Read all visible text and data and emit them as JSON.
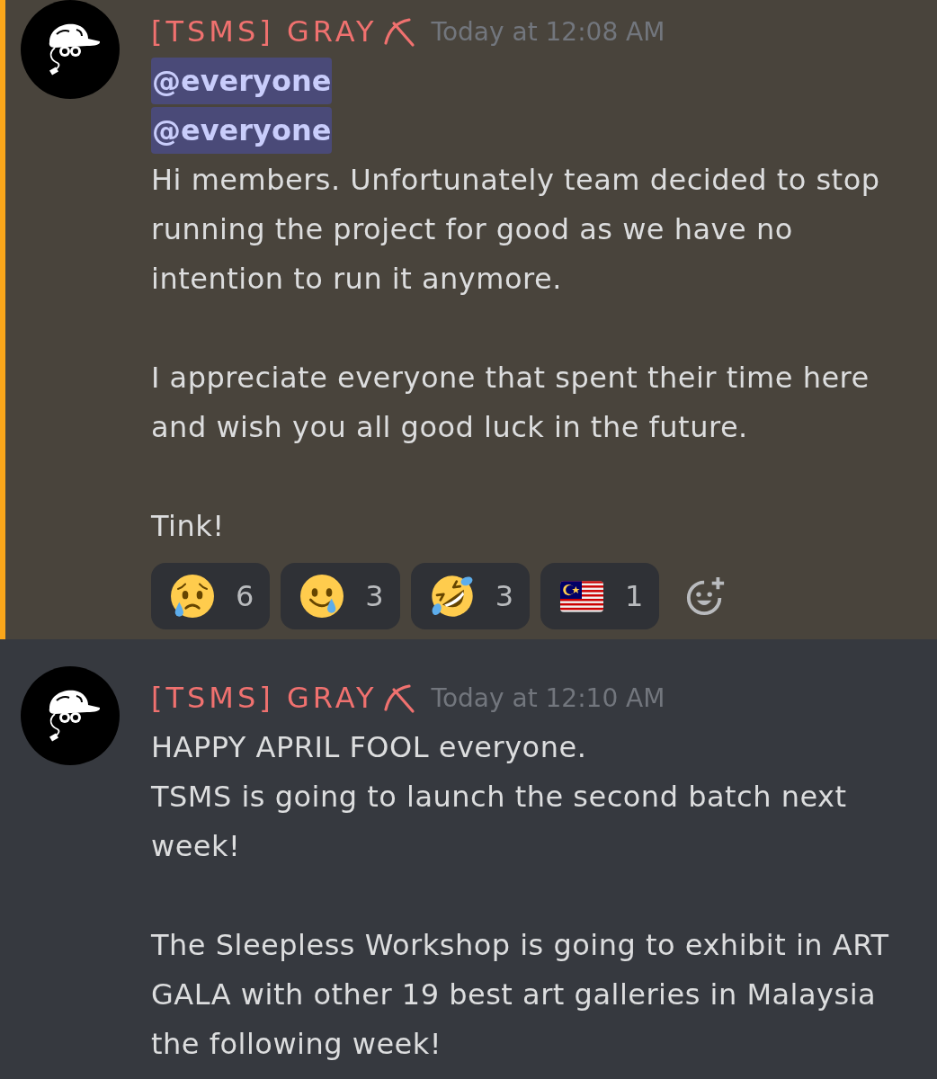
{
  "messages": [
    {
      "highlighted": true,
      "author": "[TSMS] GRAY",
      "timestamp": "Today at 12:08 AM",
      "paragraphs": [
        {
          "lines": [
            {
              "kind": "mention",
              "text": "@everyone"
            },
            {
              "kind": "mention",
              "text": "@everyone"
            },
            {
              "kind": "text",
              "text": "Hi members. Unfortunately team decided to stop running the project for good as we have no intention to run it anymore."
            }
          ]
        },
        {
          "lines": [
            {
              "kind": "text",
              "text": "I appreciate everyone that spent their time here and wish you all good luck in the future."
            }
          ]
        },
        {
          "lines": [
            {
              "kind": "text",
              "text": "Tink!"
            }
          ]
        }
      ],
      "reactions": [
        {
          "kind": "cry",
          "count": "6"
        },
        {
          "kind": "tear",
          "count": "3"
        },
        {
          "kind": "rofl",
          "count": "3"
        },
        {
          "kind": "flag",
          "count": "1"
        }
      ]
    },
    {
      "highlighted": false,
      "author": "[TSMS] GRAY",
      "timestamp": "Today at 12:10 AM",
      "paragraphs": [
        {
          "lines": [
            {
              "kind": "text",
              "text": "HAPPY APRIL FOOL everyone."
            },
            {
              "kind": "text",
              "text": "TSMS is going to launch the second batch next week!"
            }
          ]
        },
        {
          "lines": [
            {
              "kind": "text",
              "text": "The Sleepless Workshop is going to exhibit in ART GALA with other 19 best art galleries in Malaysia the following week!"
            }
          ]
        }
      ]
    }
  ]
}
